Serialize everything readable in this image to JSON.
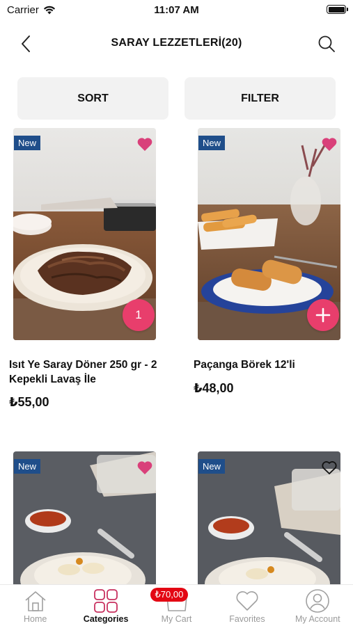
{
  "status_bar": {
    "carrier": "Carrier",
    "time": "11:07 AM"
  },
  "header": {
    "title": "SARAY LEZZETLERİ(20)",
    "back_icon": "chevron-left-icon",
    "search_icon": "search-icon"
  },
  "controls": {
    "sort_label": "SORT",
    "filter_label": "FILTER"
  },
  "products": [
    {
      "badge": "New",
      "name": "Isıt Ye Saray Döner 250 gr - 2 Kepekli Lavaş İle",
      "price": "₺55,00",
      "favorited": true,
      "cart_quantity": "1",
      "image": "doner-plate"
    },
    {
      "badge": "New",
      "name": "Paçanga Börek 12'li",
      "price": "₺48,00",
      "favorited": true,
      "cart_quantity": "",
      "image": "borek-plate"
    },
    {
      "badge": "New",
      "favorited": true,
      "image": "manti-plate"
    },
    {
      "badge": "New",
      "favorited": false,
      "image": "manti-plate-2"
    }
  ],
  "tab_bar": {
    "items": [
      {
        "label": "Home",
        "icon": "home-icon",
        "active": false
      },
      {
        "label": "Categories",
        "icon": "categories-grid-icon",
        "active": true
      },
      {
        "label": "My Cart",
        "icon": "cart-icon",
        "active": false,
        "badge": "₺70,00"
      },
      {
        "label": "Favorites",
        "icon": "heart-icon",
        "active": false
      },
      {
        "label": "My Account",
        "icon": "account-icon",
        "active": false
      }
    ]
  },
  "colors": {
    "accent": "#e83e6c",
    "badge_new": "#1f4e8a",
    "cart_badge": "#e30613",
    "button_bg": "#f2f2f2"
  }
}
